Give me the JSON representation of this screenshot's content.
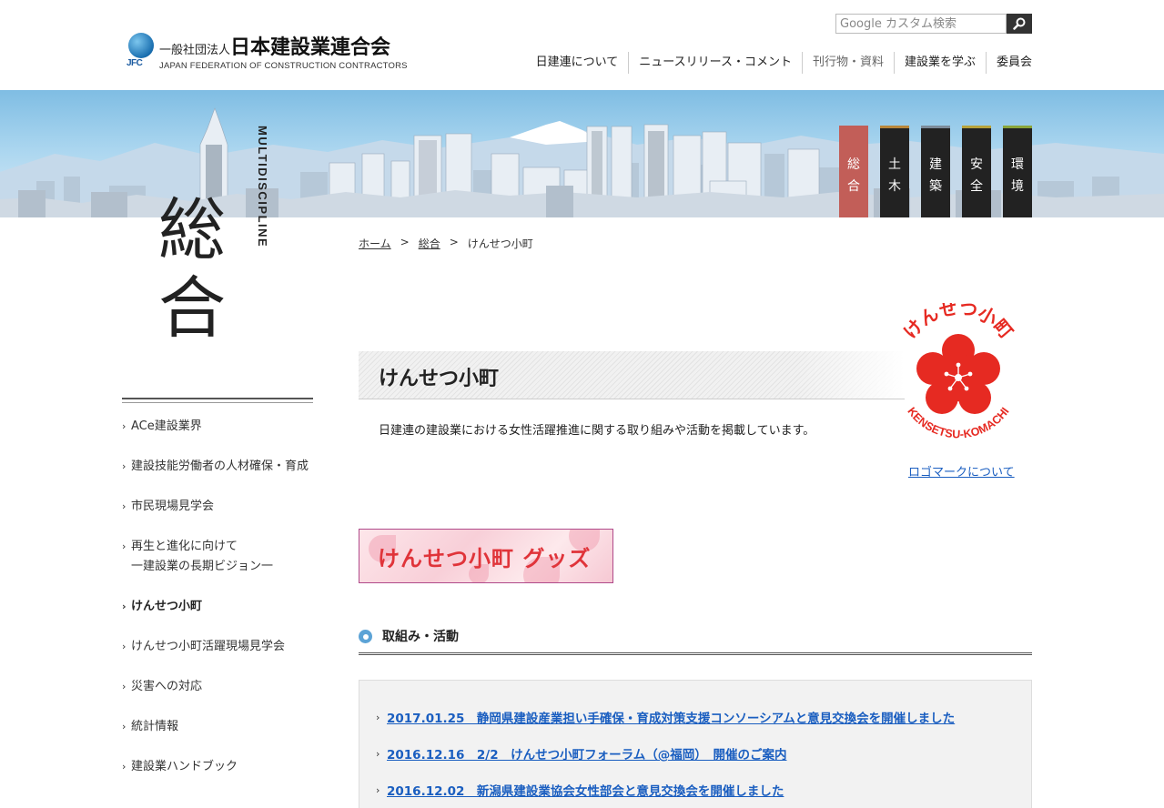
{
  "header": {
    "logo": {
      "mark_text": "JFC",
      "org_prefix": "一般社団法人",
      "org_name": "日本建設業連合会",
      "org_name_en": "JAPAN FEDERATION OF CONSTRUCTION CONTRACTORS"
    },
    "search": {
      "placeholder": "Google カスタム検索",
      "button_icon": "search-icon"
    },
    "nav": [
      {
        "label": "日建連について"
      },
      {
        "label": "ニュースリリース・コメント"
      },
      {
        "label": "刊行物・資料"
      },
      {
        "label": "建設業を学ぶ"
      },
      {
        "label": "委員会"
      }
    ]
  },
  "category_tabs": [
    {
      "label_1": "総",
      "label_2": "合",
      "active": true
    },
    {
      "label_1": "土",
      "label_2": "木"
    },
    {
      "label_1": "建",
      "label_2": "築"
    },
    {
      "label_1": "安",
      "label_2": "全"
    },
    {
      "label_1": "環",
      "label_2": "境"
    }
  ],
  "sidebar": {
    "title_1": "総",
    "title_2": "合",
    "subtitle": "MULTIDISCIPLINE",
    "items": [
      {
        "label": "ACe建設業界"
      },
      {
        "label": "建設技能労働者の人材確保・育成"
      },
      {
        "label": "市民現場見学会"
      },
      {
        "label_1": "再生と進化に向けて",
        "label_2": "一建設業の長期ビジョン一"
      },
      {
        "label": "けんせつ小町"
      },
      {
        "label": "けんせつ小町活躍現場見学会"
      },
      {
        "label": "災害への対応"
      },
      {
        "label": "統計情報"
      },
      {
        "label": "建設業ハンドブック"
      }
    ]
  },
  "breadcrumb": {
    "home": "ホーム",
    "sep": ">",
    "parent": "総合",
    "current": "けんせつ小町"
  },
  "main": {
    "title": "けんせつ小町",
    "intro": "日建連の建設業における女性活躍推進に関する取り組みや活動を掲載しています。",
    "logo_top_text": "けんせつ小町",
    "logo_bottom_text": "KENSETSU-KOMACHI",
    "logo_link": "ロゴマークについて",
    "goods_banner": "けんせつ小町 グッズ",
    "section_title": "取組み・活動",
    "news": [
      {
        "text": "2017.01.25　静岡県建設産業担い手確保・育成対策支援コンソーシアムと意見交換会を開催しました"
      },
      {
        "text": "2016.12.16　2/2　けんせつ小町フォーラム（@福岡）　開催のご案内"
      },
      {
        "text": "2016.12.02　新潟県建設業協会女性部会と意見交換会を開催しました"
      }
    ]
  },
  "colors": {
    "accent_link": "#1a5ec0",
    "active_tab": "#c25e58",
    "komachi_red": "#e62a22",
    "section_icon": "#5ca3d6"
  }
}
